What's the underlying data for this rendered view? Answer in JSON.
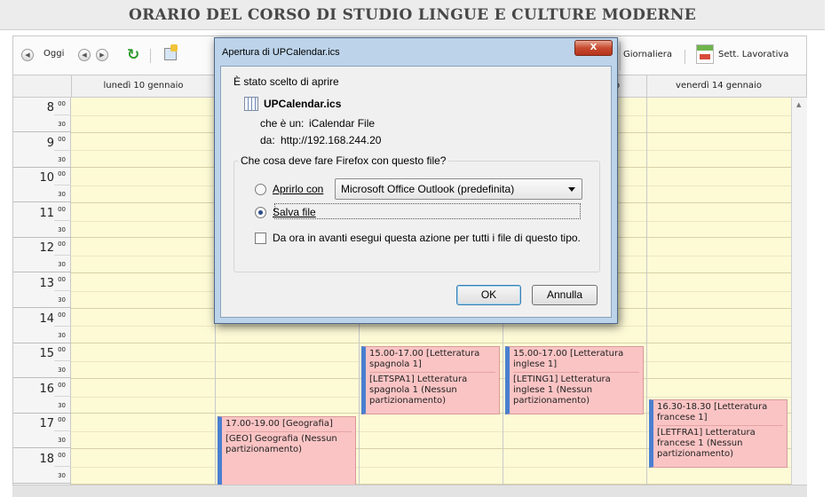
{
  "page": {
    "title": "ORARIO DEL CORSO DI STUDIO LINGUE E CULTURE MODERNE"
  },
  "toolbar": {
    "today_label": "Oggi",
    "daily_label": "Giornaliera",
    "work_week_label": "Sett. Lavorativa",
    "icons": [
      "nav-back-icon",
      "nav-prev-icon",
      "nav-next-icon",
      "refresh-icon",
      "export-icon",
      "calendar-week-icon"
    ]
  },
  "calendar": {
    "days": [
      {
        "label": "lunedì 10 gennaio"
      },
      {
        "label": ""
      },
      {
        "label": ""
      },
      {
        "label": "o"
      },
      {
        "label": "venerdì 14 gennaio"
      }
    ],
    "hours": [
      "8",
      "9",
      "10",
      "11",
      "12",
      "13",
      "14",
      "15",
      "16",
      "17",
      "18"
    ],
    "minute_full": "00",
    "minute_half": "30",
    "events": [
      {
        "day": 2,
        "start": 15.0,
        "end": 17.0,
        "title": "15.00-17.00 [Letteratura spagnola 1]",
        "description": "[LETSPA1] Letteratura spagnola 1 (Nessun partizionamento)"
      },
      {
        "day": 3,
        "start": 15.0,
        "end": 17.0,
        "title": "15.00-17.00 [Letteratura inglese 1]",
        "description": "[LETING1] Letteratura inglese 1 (Nessun partizionamento)"
      },
      {
        "day": 1,
        "start": 17.0,
        "end": 19.0,
        "title": "17.00-19.00 [Geografia]",
        "description": "[GEO] Geografia (Nessun partizionamento)"
      },
      {
        "day": 4,
        "start": 16.5,
        "end": 18.5,
        "title": "16.30-18.30 [Letteratura francese 1]",
        "description": "[LETFRA1] Letteratura francese 1 (Nessun partizionamento)"
      }
    ]
  },
  "dialog": {
    "title": "Apertura di UPCalendar.ics",
    "close_label": "X",
    "intro": "È stato scelto di aprire",
    "file_name": "UPCalendar.ics",
    "file_type_label": "che è un:",
    "file_type": "iCalendar File",
    "source_label": "da:",
    "source": "http://192.168.244.20",
    "question": "Che cosa deve fare Firefox con questo file?",
    "open_with_label": "Aprirlo con",
    "open_with_app": "Microsoft Office Outlook (predefinita)",
    "save_label": "Salva file",
    "remember_label": "Da ora in avanti esegui questa azione per tutti i file di questo tipo.",
    "ok_label": "OK",
    "cancel_label": "Annulla",
    "selected_option": "save",
    "remember_checked": false
  }
}
